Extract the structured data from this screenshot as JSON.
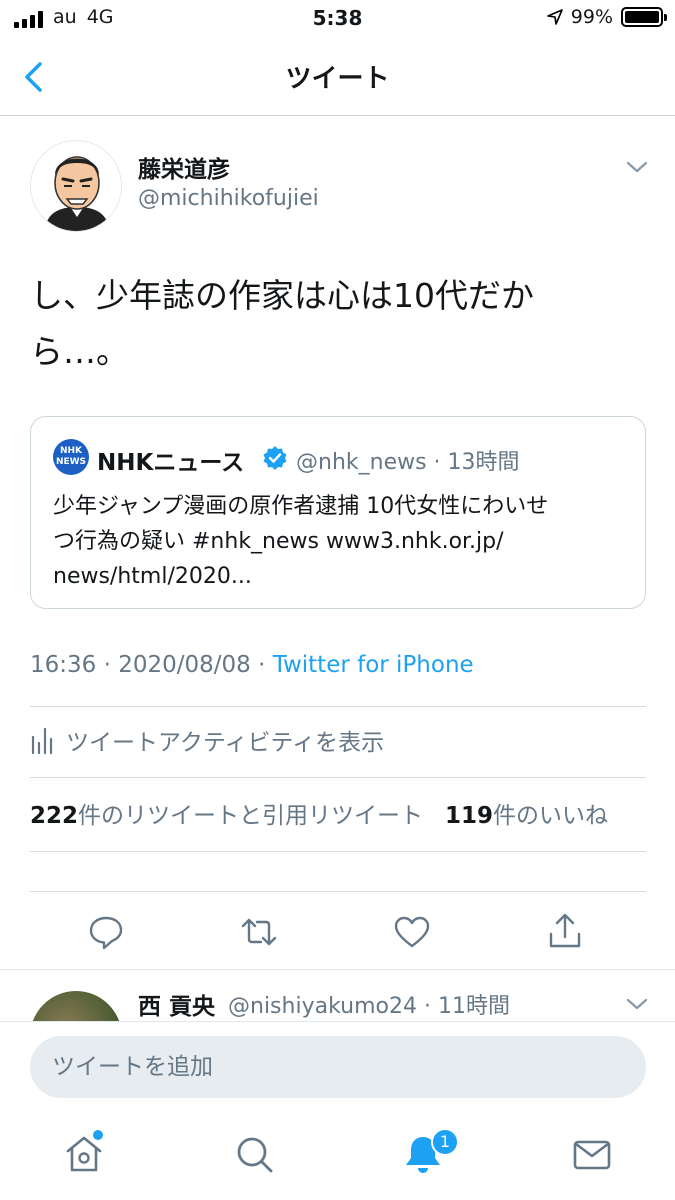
{
  "status_bar": {
    "carrier": "au",
    "network": "4G",
    "time": "5:38",
    "battery": "99%",
    "battery_level": 0.99
  },
  "nav": {
    "title": "ツイート",
    "back_icon": "chevron-left-icon"
  },
  "tweet": {
    "author_name": "藤栄道彦",
    "author_handle": "@michihikofujiei",
    "text_line1": "し、少年誌の作家は心は10代だか",
    "text_line2": "ら…。",
    "quote": {
      "logo_line1": "NHK",
      "logo_line2": "NEWS",
      "name": "NHKニュース",
      "handle_time": "@nhk_news · 13時間",
      "text_line1": "少年ジャンプ漫画の原作者逮捕 10代女性にわいせ",
      "text_line2": "つ行為の疑い #nhk_news www3.nhk.or.jp/",
      "text_line3": "news/html/2020..."
    },
    "timestamp": "16:36 · 2020/08/08 · ",
    "source": "Twitter for iPhone",
    "activity_label": "ツイートアクティビティを表示",
    "retweet_count": "222",
    "retweet_label": "件のリツイートと引用リツイート",
    "like_count": "119",
    "like_label": "件のいいね"
  },
  "actions": {
    "reply_icon": "reply-icon",
    "retweet_icon": "retweet-icon",
    "like_icon": "heart-icon",
    "share_icon": "share-icon"
  },
  "reply": {
    "name": "西 貢央",
    "handle_time": "@nishiyakumo24 · 11時間"
  },
  "compose": {
    "placeholder": "ツイートを追加"
  },
  "tab_bar": {
    "notifications_badge": "1"
  },
  "colors": {
    "accent": "#1da1f2",
    "secondary_text": "#657786",
    "nhk_blue": "#1d5fc4"
  }
}
